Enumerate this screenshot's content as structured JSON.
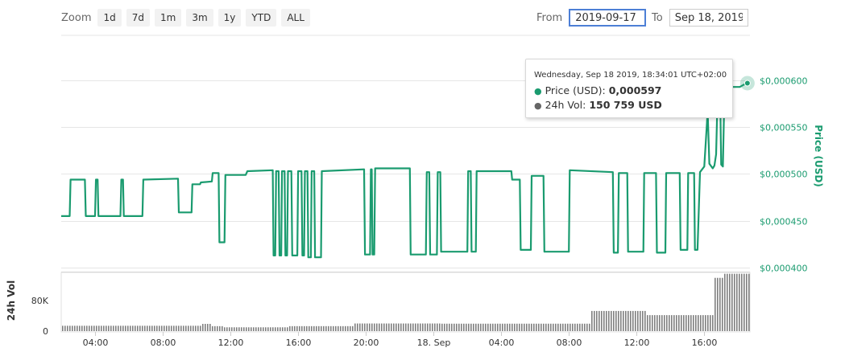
{
  "zoom": {
    "label": "Zoom",
    "buttons": [
      "1d",
      "7d",
      "1m",
      "3m",
      "1y",
      "YTD",
      "ALL"
    ]
  },
  "range": {
    "from_label": "From",
    "from_value": "2019-09-17",
    "to_label": "To",
    "to_value": "Sep 18, 2019"
  },
  "tooltip": {
    "date": "Wednesday, Sep 18 2019, 18:34:01 UTC+02:00",
    "price_label": "Price (USD):",
    "price_value": "0,000597",
    "vol_label": "24h Vol:",
    "vol_value": "150 759 USD"
  },
  "colors": {
    "price": "#1a9b6f",
    "volume": "#7f7f7f",
    "grid": "#e6e6e6"
  },
  "chart_data": [
    {
      "type": "line",
      "title": "",
      "ylabel": "Price (USD)",
      "x_unit": "hours since 17 Sep 2019 02:00 (UTC+02:00)",
      "xlim": [
        0,
        40.7
      ],
      "x_ticks": [
        {
          "x": 2,
          "label": "04:00"
        },
        {
          "x": 6,
          "label": "08:00"
        },
        {
          "x": 10,
          "label": "12:00"
        },
        {
          "x": 14,
          "label": "16:00"
        },
        {
          "x": 18,
          "label": "20:00"
        },
        {
          "x": 22,
          "label": "18. Sep"
        },
        {
          "x": 26,
          "label": "04:00"
        },
        {
          "x": 30,
          "label": "08:00"
        },
        {
          "x": 34,
          "label": "12:00"
        },
        {
          "x": 38,
          "label": "16:00"
        }
      ],
      "ylim": [
        0.0004,
        0.0006
      ],
      "y_ticks": [
        {
          "value": 0.0004,
          "label": "$0,000400"
        },
        {
          "value": 0.00045,
          "label": "$0,000450"
        },
        {
          "value": 0.0005,
          "label": "$0,000500"
        },
        {
          "value": 0.00055,
          "label": "$0,000550"
        },
        {
          "value": 0.0006,
          "label": "$0,000600"
        }
      ],
      "axis_side": "right",
      "grid": true,
      "series": [
        {
          "color": "#1a9b6f",
          "points": [
            [
              0.0,
              0.000455
            ],
            [
              0.5,
              0.000455
            ],
            [
              0.55,
              0.000494
            ],
            [
              1.4,
              0.000494
            ],
            [
              1.45,
              0.000455
            ],
            [
              2.0,
              0.000455
            ],
            [
              2.05,
              0.000494
            ],
            [
              2.15,
              0.000494
            ],
            [
              2.2,
              0.000455
            ],
            [
              3.5,
              0.000455
            ],
            [
              3.55,
              0.000494
            ],
            [
              3.65,
              0.000494
            ],
            [
              3.7,
              0.000455
            ],
            [
              4.8,
              0.000455
            ],
            [
              4.85,
              0.000494
            ],
            [
              6.9,
              0.000495
            ],
            [
              6.95,
              0.000459
            ],
            [
              7.7,
              0.000459
            ],
            [
              7.75,
              0.000489
            ],
            [
              8.2,
              0.000489
            ],
            [
              8.25,
              0.000491
            ],
            [
              8.9,
              0.000492
            ],
            [
              8.95,
              0.000501
            ],
            [
              9.3,
              0.000501
            ],
            [
              9.35,
              0.000427
            ],
            [
              9.65,
              0.000427
            ],
            [
              9.7,
              0.000499
            ],
            [
              10.9,
              0.000499
            ],
            [
              11.0,
              0.000503
            ],
            [
              12.5,
              0.000504
            ],
            [
              12.55,
              0.000413
            ],
            [
              12.65,
              0.000413
            ],
            [
              12.7,
              0.000503
            ],
            [
              12.85,
              0.000503
            ],
            [
              12.9,
              0.000413
            ],
            [
              13.0,
              0.000413
            ],
            [
              13.05,
              0.000503
            ],
            [
              13.2,
              0.000503
            ],
            [
              13.25,
              0.000413
            ],
            [
              13.35,
              0.000413
            ],
            [
              13.4,
              0.000503
            ],
            [
              13.6,
              0.000503
            ],
            [
              13.65,
              0.000413
            ],
            [
              13.95,
              0.000413
            ],
            [
              14.0,
              0.000503
            ],
            [
              14.2,
              0.000503
            ],
            [
              14.25,
              0.000413
            ],
            [
              14.35,
              0.000413
            ],
            [
              14.4,
              0.000503
            ],
            [
              14.55,
              0.000503
            ],
            [
              14.6,
              0.000411
            ],
            [
              14.75,
              0.000411
            ],
            [
              14.8,
              0.000503
            ],
            [
              14.95,
              0.000503
            ],
            [
              15.0,
              0.000411
            ],
            [
              15.35,
              0.000411
            ],
            [
              15.4,
              0.000503
            ],
            [
              17.9,
              0.000505
            ],
            [
              17.95,
              0.000414
            ],
            [
              18.25,
              0.000414
            ],
            [
              18.3,
              0.000505
            ],
            [
              18.35,
              0.000505
            ],
            [
              18.4,
              0.000414
            ],
            [
              18.5,
              0.000414
            ],
            [
              18.55,
              0.000506
            ],
            [
              20.6,
              0.000506
            ],
            [
              20.65,
              0.000414
            ],
            [
              21.55,
              0.000414
            ],
            [
              21.6,
              0.000502
            ],
            [
              21.75,
              0.000502
            ],
            [
              21.8,
              0.000414
            ],
            [
              22.2,
              0.000414
            ],
            [
              22.25,
              0.000502
            ],
            [
              22.4,
              0.000502
            ],
            [
              22.45,
              0.000417
            ],
            [
              24.0,
              0.000417
            ],
            [
              24.05,
              0.000503
            ],
            [
              24.2,
              0.000503
            ],
            [
              24.25,
              0.000417
            ],
            [
              24.5,
              0.000417
            ],
            [
              24.55,
              0.000503
            ],
            [
              26.6,
              0.000503
            ],
            [
              26.65,
              0.000494
            ],
            [
              27.1,
              0.000494
            ],
            [
              27.15,
              0.000419
            ],
            [
              27.75,
              0.000419
            ],
            [
              27.8,
              0.000498
            ],
            [
              28.5,
              0.000498
            ],
            [
              28.55,
              0.000417
            ],
            [
              30.0,
              0.000417
            ],
            [
              30.05,
              0.000504
            ],
            [
              32.6,
              0.000502
            ],
            [
              32.65,
              0.000416
            ],
            [
              32.9,
              0.000416
            ],
            [
              32.95,
              0.000501
            ],
            [
              33.45,
              0.000501
            ],
            [
              33.5,
              0.000417
            ],
            [
              34.4,
              0.000417
            ],
            [
              34.45,
              0.000501
            ],
            [
              35.15,
              0.000501
            ],
            [
              35.2,
              0.000416
            ],
            [
              35.7,
              0.000416
            ],
            [
              35.75,
              0.000501
            ],
            [
              36.55,
              0.000501
            ],
            [
              36.6,
              0.000419
            ],
            [
              37.0,
              0.000419
            ],
            [
              37.05,
              0.000501
            ],
            [
              37.4,
              0.000501
            ],
            [
              37.45,
              0.000419
            ],
            [
              37.6,
              0.000419
            ],
            [
              37.75,
              0.000502
            ],
            [
              38.0,
              0.000508
            ],
            [
              38.2,
              0.000567
            ],
            [
              38.3,
              0.000511
            ],
            [
              38.5,
              0.000506
            ],
            [
              38.6,
              0.000509
            ],
            [
              38.7,
              0.000521
            ],
            [
              38.8,
              0.000593
            ],
            [
              38.9,
              0.000594
            ],
            [
              38.95,
              0.000573
            ],
            [
              39.0,
              0.00051
            ],
            [
              39.1,
              0.000508
            ],
            [
              39.2,
              0.000593
            ],
            [
              40.1,
              0.000593
            ],
            [
              40.3,
              0.000595
            ],
            [
              40.55,
              0.000597
            ]
          ],
          "highlight": {
            "x": 40.55,
            "y": 0.000597
          }
        }
      ]
    },
    {
      "type": "bar",
      "title": "",
      "ylabel": "24h Vol",
      "xlim": [
        0,
        40.7
      ],
      "ylim": [
        0,
        150000
      ],
      "y_ticks": [
        {
          "value": 0,
          "label": "0"
        },
        {
          "value": 80000,
          "label": "80K"
        }
      ],
      "axis_side": "left",
      "steps": [
        {
          "from": 0,
          "to": 8.3,
          "value": 14000
        },
        {
          "from": 8.3,
          "to": 8.8,
          "value": 19000
        },
        {
          "from": 8.8,
          "to": 9.6,
          "value": 13000
        },
        {
          "from": 9.6,
          "to": 13.4,
          "value": 10000
        },
        {
          "from": 13.4,
          "to": 17.2,
          "value": 13000
        },
        {
          "from": 17.2,
          "to": 22.4,
          "value": 20000
        },
        {
          "from": 22.4,
          "to": 31.3,
          "value": 19500
        },
        {
          "from": 31.3,
          "to": 34.6,
          "value": 53000
        },
        {
          "from": 34.6,
          "to": 38.6,
          "value": 42000
        },
        {
          "from": 38.6,
          "to": 39.1,
          "value": 140000
        },
        {
          "from": 39.1,
          "to": 40.7,
          "value": 150759
        }
      ]
    }
  ]
}
